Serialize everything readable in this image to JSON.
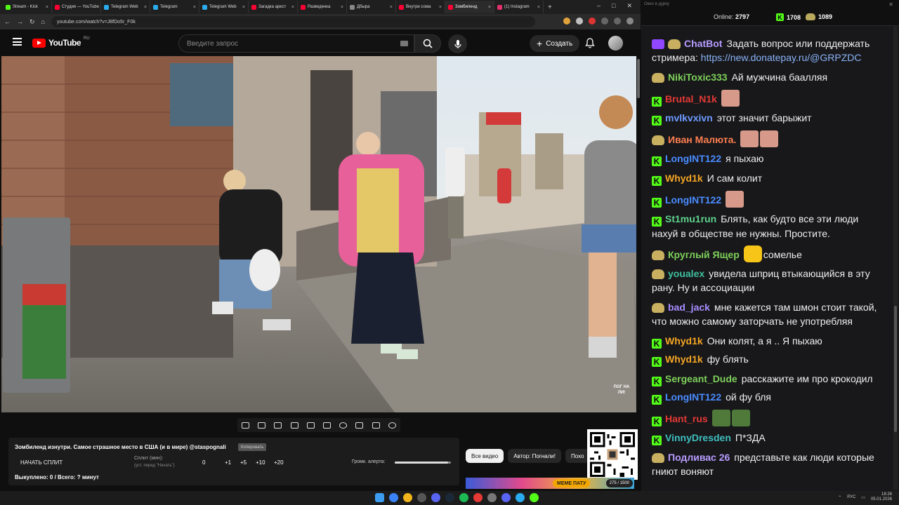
{
  "browser": {
    "tabs": [
      {
        "label": "Stream - Kick",
        "color": "#53fc18",
        "active": false
      },
      {
        "label": "Студия — YouTube",
        "color": "#ff0033",
        "active": false
      },
      {
        "label": "Telegram Web",
        "color": "#2aabee",
        "active": false
      },
      {
        "label": "Telegram",
        "color": "#2aabee",
        "active": false
      },
      {
        "label": "Telegram Web",
        "color": "#2aabee",
        "active": false
      },
      {
        "label": "Загадка арест",
        "color": "#ff0033",
        "active": false
      },
      {
        "label": "Разведенка",
        "color": "#ff0033",
        "active": false
      },
      {
        "label": "Дбыра",
        "color": "#888888",
        "active": false
      },
      {
        "label": "Внутри сома",
        "color": "#ff0033",
        "active": false
      },
      {
        "label": "Зомбиленд",
        "color": "#ff0033",
        "active": true
      },
      {
        "label": "(1) Instagram",
        "color": "#e1306c",
        "active": false
      }
    ],
    "url": "youtube.com/watch?v=J8fDo5r_F0k"
  },
  "youtube": {
    "logo_text": "YouTube",
    "region": "RU",
    "search_placeholder": "Введите запрос",
    "create_label": "Создать"
  },
  "controls": {
    "icons": [
      "loop-icon",
      "broadcast-icon",
      "cast-icon",
      "clip-icon",
      "miniplayer-icon",
      "theater-icon",
      "speed-icon",
      "add-icon",
      "screenshot-icon",
      "settings-icon"
    ]
  },
  "panel": {
    "title": "Зомбиленд изнутри. Самое страшное место в США (и в мире) @staspognali",
    "tag": "Копировать",
    "start_split": "НАЧАТЬ СПЛИТ",
    "split_label": "Сплит (мин):",
    "split_hint": "(уст. перед \"Начать\")",
    "split_value": "0",
    "increments": [
      "+1",
      "+5",
      "+10",
      "+20"
    ],
    "alert_label": "Громк. алерта:",
    "alert_volume": 0.95,
    "bought": "Выкуплено: 0 / Всего: ? минут"
  },
  "chips": [
    "Все видео",
    "Автор: Погнали!",
    "Похо"
  ],
  "thumb": {
    "badge": "МЕМЕ ПАТУ",
    "count": "275 / 1500"
  },
  "video_watermark": "ПОГ НА ЛИ!",
  "chat": {
    "window_title": "Окно в дурку",
    "online_label": "Online:",
    "online_count": "2797",
    "stat_kick": "1708",
    "stat_other": "1089",
    "messages": [
      {
        "badge": "bi+bp",
        "nick": "ChatBot",
        "color": "#b79cff",
        "text": "Задать вопрос или поддержать стримера: ",
        "link": "https://new.donatepay.ru/@GRPZDC",
        "emote": ""
      },
      {
        "badge": "bp",
        "nick": "NikiToxic333",
        "color": "#7ed05a",
        "text": "Ай мужчина баалляя",
        "link": "",
        "emote": ""
      },
      {
        "badge": "bk",
        "nick": "Brutal_N1k",
        "color": "#e53935",
        "text": "",
        "link": "",
        "emote": "face"
      },
      {
        "badge": "bk",
        "nick": "mvlkvxivn",
        "color": "#6f9bff",
        "text": "этот значит барыжит",
        "link": "",
        "emote": ""
      },
      {
        "badge": "bp",
        "nick": "Иван Малюта.",
        "color": "#ff7f50",
        "text": "",
        "link": "",
        "emote": "face2"
      },
      {
        "badge": "bk",
        "nick": "LongINT122",
        "color": "#4a8cff",
        "text": "я пыхаю",
        "link": "",
        "emote": ""
      },
      {
        "badge": "bk",
        "nick": "Whyd1k",
        "color": "#f5a623",
        "text": "И сам колит",
        "link": "",
        "emote": ""
      },
      {
        "badge": "bk",
        "nick": "LongINT122",
        "color": "#4a8cff",
        "text": "",
        "link": "",
        "emote": "face"
      },
      {
        "badge": "bk",
        "nick": "St1mu1run",
        "color": "#5fd38d",
        "text": "Блять, как будто все эти люди нахуй в обществе не нужны. Простите.",
        "link": "",
        "emote": ""
      },
      {
        "badge": "bp",
        "nick": "Круглый Ящер",
        "color": "#7ed05a",
        "text": "сомелье",
        "link": "",
        "emote": "smile"
      },
      {
        "badge": "bp",
        "nick": "youalex",
        "color": "#3fbf9f",
        "text": "увидела шприц втыкающийся в эту рану. Ну и ассоциации",
        "link": "",
        "emote": ""
      },
      {
        "badge": "bp",
        "nick": "bad_jack",
        "color": "#a68cff",
        "text": "мне кажется там шмон стоит такой, что можно самому заторчать не употребляя",
        "link": "",
        "emote": ""
      },
      {
        "badge": "bk",
        "nick": "Whyd1k",
        "color": "#f5a623",
        "text": "Они колят, а я .. Я пыхаю",
        "link": "",
        "emote": ""
      },
      {
        "badge": "bk",
        "nick": "Whyd1k",
        "color": "#f5a623",
        "text": "фу блять",
        "link": "",
        "emote": ""
      },
      {
        "badge": "bk",
        "nick": "Sergeant_Dude",
        "color": "#7ed05a",
        "text": "расскажите им про крокодил",
        "link": "",
        "emote": ""
      },
      {
        "badge": "bk",
        "nick": "LongINT122",
        "color": "#4a8cff",
        "text": "ой фу бля",
        "link": "",
        "emote": ""
      },
      {
        "badge": "bk",
        "nick": "Hant_rus",
        "color": "#e53935",
        "text": "",
        "link": "",
        "emote": "pepe2"
      },
      {
        "badge": "bk",
        "nick": "VinnyDresden",
        "color": "#3fbfbf",
        "text": "П*ЗДА",
        "link": "",
        "emote": ""
      },
      {
        "badge": "bp",
        "nick": "Подливас 26",
        "color": "#b79cff",
        "text": "представьте как люди которые гниют воняют",
        "link": "",
        "emote": ""
      }
    ]
  },
  "taskbar": {
    "lang": "РУС",
    "time": "18:26",
    "date": "05.01.2026",
    "apps": [
      "#3b82f6",
      "#f2b51c",
      "#555555",
      "#5865f2",
      "#1b2838",
      "#1db954",
      "#e53935",
      "#777777",
      "#5865f2",
      "#2aabee",
      "#53fc18"
    ]
  }
}
